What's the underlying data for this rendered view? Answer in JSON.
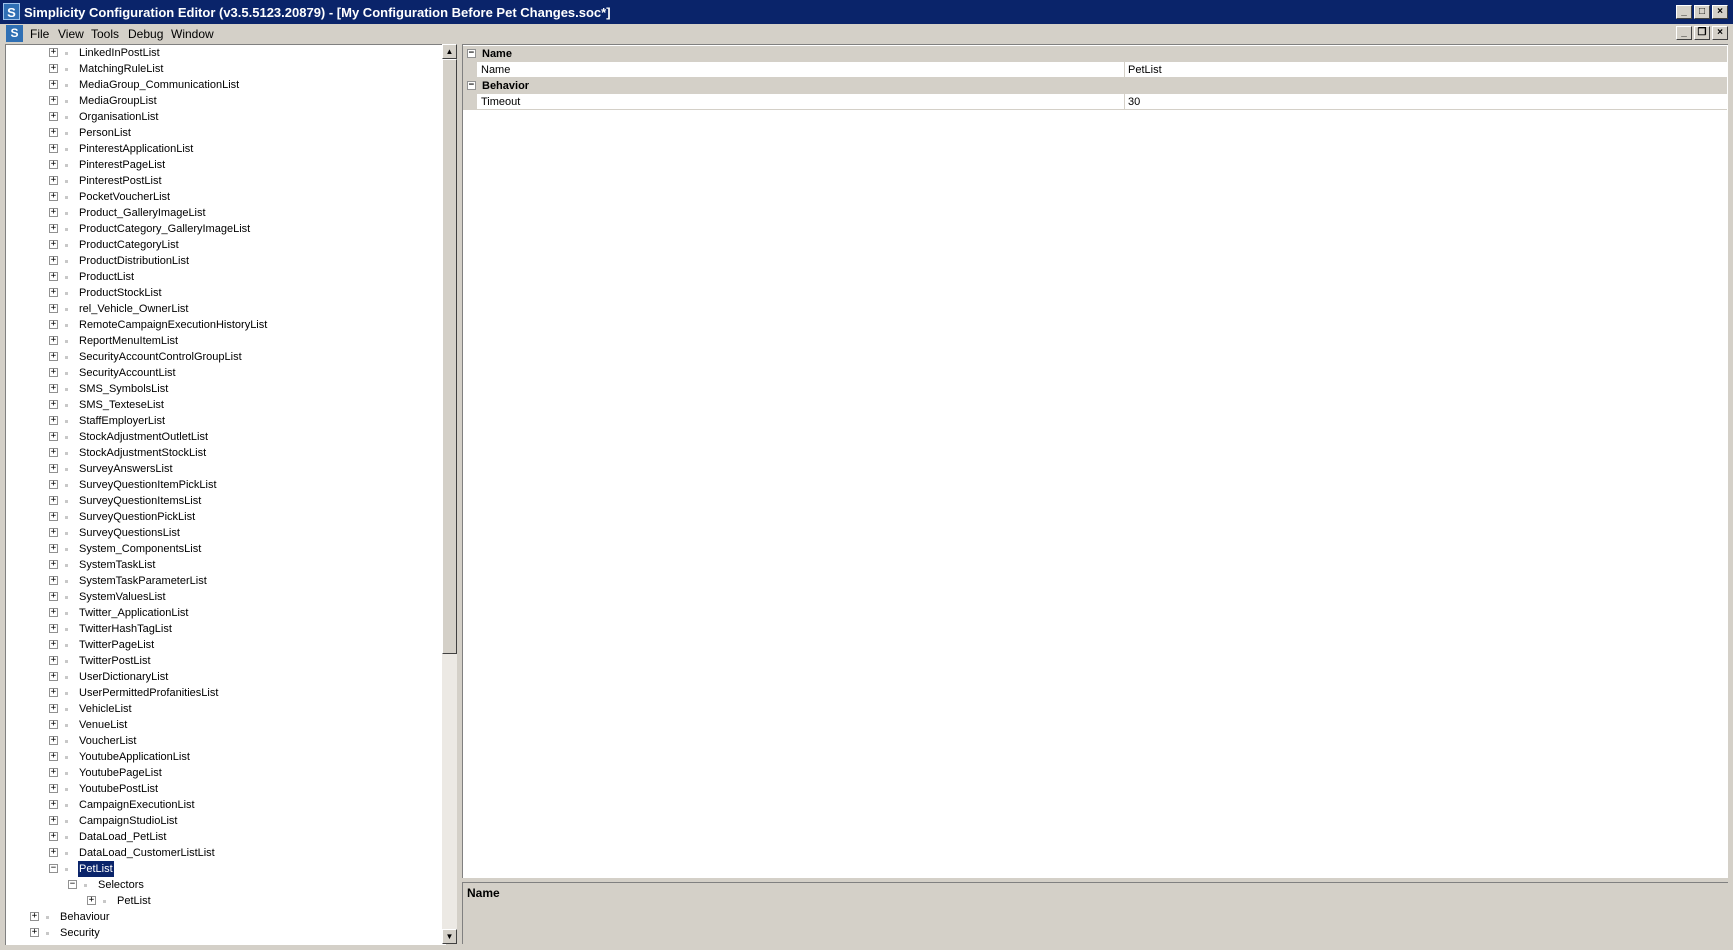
{
  "window": {
    "title": "Simplicity Configuration Editor (v3.5.5123.20879) - [My Configuration Before Pet Changes.soc*]",
    "app_icon": "S"
  },
  "menu": {
    "items": [
      "File",
      "View",
      "Tools",
      "Debug",
      "Window"
    ]
  },
  "tree": {
    "items": [
      {
        "label": "LinkedInPostList",
        "level": 2,
        "expander": "+"
      },
      {
        "label": "MatchingRuleList",
        "level": 2,
        "expander": "+"
      },
      {
        "label": "MediaGroup_CommunicationList",
        "level": 2,
        "expander": "+"
      },
      {
        "label": "MediaGroupList",
        "level": 2,
        "expander": "+"
      },
      {
        "label": "OrganisationList",
        "level": 2,
        "expander": "+"
      },
      {
        "label": "PersonList",
        "level": 2,
        "expander": "+"
      },
      {
        "label": "PinterestApplicationList",
        "level": 2,
        "expander": "+"
      },
      {
        "label": "PinterestPageList",
        "level": 2,
        "expander": "+"
      },
      {
        "label": "PinterestPostList",
        "level": 2,
        "expander": "+"
      },
      {
        "label": "PocketVoucherList",
        "level": 2,
        "expander": "+"
      },
      {
        "label": "Product_GalleryImageList",
        "level": 2,
        "expander": "+"
      },
      {
        "label": "ProductCategory_GalleryImageList",
        "level": 2,
        "expander": "+"
      },
      {
        "label": "ProductCategoryList",
        "level": 2,
        "expander": "+"
      },
      {
        "label": "ProductDistributionList",
        "level": 2,
        "expander": "+"
      },
      {
        "label": "ProductList",
        "level": 2,
        "expander": "+"
      },
      {
        "label": "ProductStockList",
        "level": 2,
        "expander": "+"
      },
      {
        "label": "rel_Vehicle_OwnerList",
        "level": 2,
        "expander": "+"
      },
      {
        "label": "RemoteCampaignExecutionHistoryList",
        "level": 2,
        "expander": "+"
      },
      {
        "label": "ReportMenuItemList",
        "level": 2,
        "expander": "+"
      },
      {
        "label": "SecurityAccountControlGroupList",
        "level": 2,
        "expander": "+"
      },
      {
        "label": "SecurityAccountList",
        "level": 2,
        "expander": "+"
      },
      {
        "label": "SMS_SymbolsList",
        "level": 2,
        "expander": "+"
      },
      {
        "label": "SMS_TexteseList",
        "level": 2,
        "expander": "+"
      },
      {
        "label": "StaffEmployerList",
        "level": 2,
        "expander": "+"
      },
      {
        "label": "StockAdjustmentOutletList",
        "level": 2,
        "expander": "+"
      },
      {
        "label": "StockAdjustmentStockList",
        "level": 2,
        "expander": "+"
      },
      {
        "label": "SurveyAnswersList",
        "level": 2,
        "expander": "+"
      },
      {
        "label": "SurveyQuestionItemPickList",
        "level": 2,
        "expander": "+"
      },
      {
        "label": "SurveyQuestionItemsList",
        "level": 2,
        "expander": "+"
      },
      {
        "label": "SurveyQuestionPickList",
        "level": 2,
        "expander": "+"
      },
      {
        "label": "SurveyQuestionsList",
        "level": 2,
        "expander": "+"
      },
      {
        "label": "System_ComponentsList",
        "level": 2,
        "expander": "+"
      },
      {
        "label": "SystemTaskList",
        "level": 2,
        "expander": "+"
      },
      {
        "label": "SystemTaskParameterList",
        "level": 2,
        "expander": "+"
      },
      {
        "label": "SystemValuesList",
        "level": 2,
        "expander": "+"
      },
      {
        "label": "Twitter_ApplicationList",
        "level": 2,
        "expander": "+"
      },
      {
        "label": "TwitterHashTagList",
        "level": 2,
        "expander": "+"
      },
      {
        "label": "TwitterPageList",
        "level": 2,
        "expander": "+"
      },
      {
        "label": "TwitterPostList",
        "level": 2,
        "expander": "+"
      },
      {
        "label": "UserDictionaryList",
        "level": 2,
        "expander": "+"
      },
      {
        "label": "UserPermittedProfanitiesList",
        "level": 2,
        "expander": "+"
      },
      {
        "label": "VehicleList",
        "level": 2,
        "expander": "+"
      },
      {
        "label": "VenueList",
        "level": 2,
        "expander": "+"
      },
      {
        "label": "VoucherList",
        "level": 2,
        "expander": "+"
      },
      {
        "label": "YoutubeApplicationList",
        "level": 2,
        "expander": "+"
      },
      {
        "label": "YoutubePageList",
        "level": 2,
        "expander": "+"
      },
      {
        "label": "YoutubePostList",
        "level": 2,
        "expander": "+"
      },
      {
        "label": "CampaignExecutionList",
        "level": 2,
        "expander": "+"
      },
      {
        "label": "CampaignStudioList",
        "level": 2,
        "expander": "+"
      },
      {
        "label": "DataLoad_PetList",
        "level": 2,
        "expander": "+"
      },
      {
        "label": "DataLoad_CustomerListList",
        "level": 2,
        "expander": "+"
      },
      {
        "label": "PetList",
        "level": 2,
        "expander": "−",
        "selected": true
      },
      {
        "label": "Selectors",
        "level": 3,
        "expander": "−"
      },
      {
        "label": "PetList",
        "level": 4,
        "expander": "+"
      },
      {
        "label": "Behaviour",
        "level": 1,
        "expander": "+"
      },
      {
        "label": "Security",
        "level": 1,
        "expander": "+"
      }
    ]
  },
  "property_grid": {
    "categories": [
      {
        "label": "Name",
        "expander": "−",
        "properties": [
          {
            "name": "Name",
            "value": "PetList"
          }
        ]
      },
      {
        "label": "Behavior",
        "expander": "−",
        "properties": [
          {
            "name": "Timeout",
            "value": "30"
          }
        ]
      }
    ]
  },
  "description": {
    "title": "Name"
  }
}
